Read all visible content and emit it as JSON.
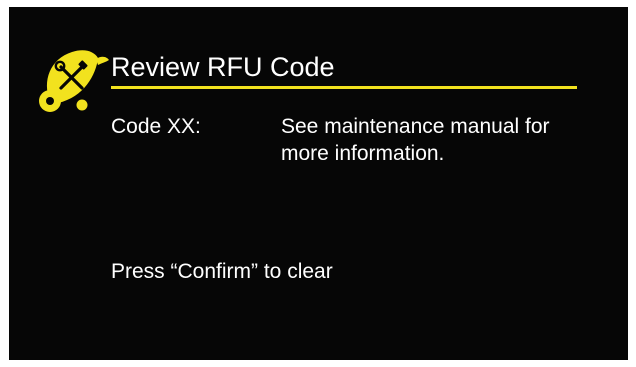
{
  "screen": {
    "title": "Review RFU Code",
    "accent_color": "#f2e21e",
    "background_color": "#060606",
    "logo_icon": "maintenance-tools-badge-icon"
  },
  "code": {
    "label": "Code XX:",
    "description": "See maintenance manual for more information."
  },
  "prompt": "Press “Confirm” to clear"
}
